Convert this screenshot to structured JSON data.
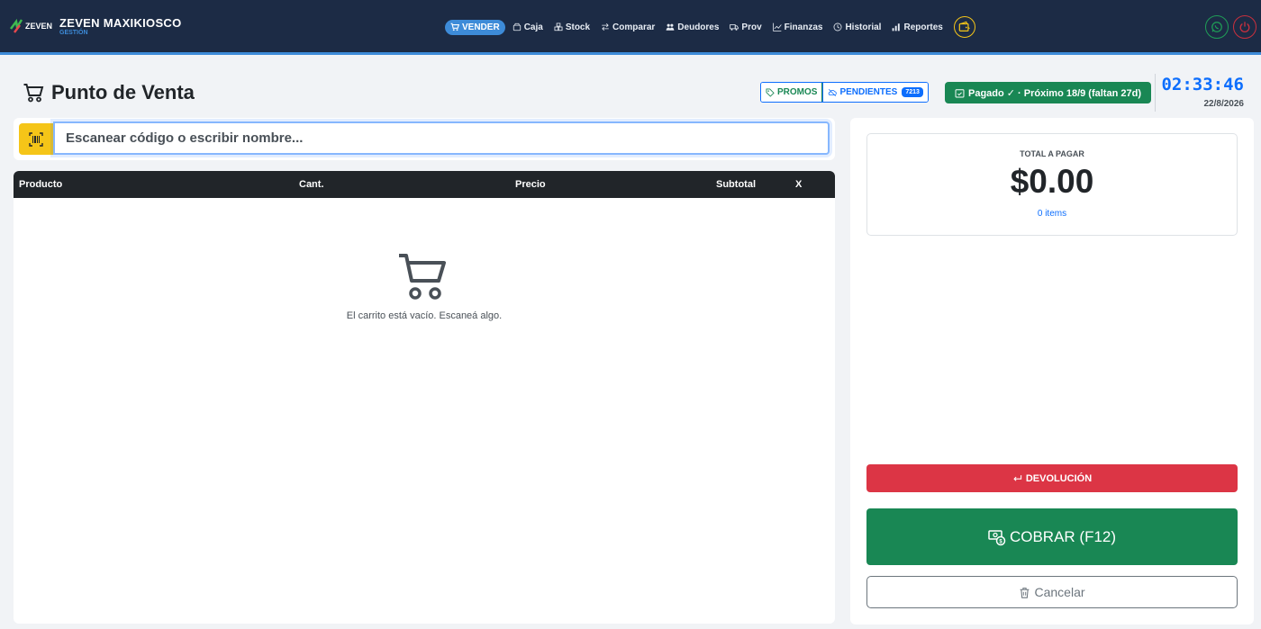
{
  "brand": {
    "logo_text": "ZEVEN",
    "title": "ZEVEN MAXIKIOSCO",
    "subtitle": "GESTIÓN"
  },
  "nav": {
    "items": [
      {
        "label": "VENDER",
        "icon": "cart-icon",
        "active": true
      },
      {
        "label": "Caja",
        "icon": "cash-register-icon"
      },
      {
        "label": "Stock",
        "icon": "boxes-icon"
      },
      {
        "label": "Comparar",
        "icon": "arrows-exchange-icon"
      },
      {
        "label": "Deudores",
        "icon": "people-icon"
      },
      {
        "label": "Prov",
        "icon": "truck-icon"
      },
      {
        "label": "Finanzas",
        "icon": "graph-up-icon"
      },
      {
        "label": "Historial",
        "icon": "clock-history-icon"
      },
      {
        "label": "Reportes",
        "icon": "bar-chart-icon"
      }
    ],
    "wallet_icon": "wallet-icon",
    "whatsapp_icon": "whatsapp-icon",
    "power_icon": "power-icon"
  },
  "header": {
    "title": "Punto de Venta",
    "promos_label": "PROMOS",
    "pendientes_label": "PENDIENTES",
    "pendientes_count": "7213",
    "paid_status": "Pagado ✓ · Próximo 18/9 (faltan 27d)",
    "clock": "02:33:46",
    "date": "22/8/2026"
  },
  "search": {
    "placeholder": "Escanear código o escribir nombre..."
  },
  "cart": {
    "columns": [
      "Producto",
      "Cant.",
      "Precio",
      "Subtotal",
      "X"
    ],
    "empty_message": "El carrito está vacío. Escaneá algo."
  },
  "summary": {
    "total_label": "TOTAL A PAGAR",
    "total_amount": "$0.00",
    "items_text": "0 items"
  },
  "actions": {
    "devolucion": "DEVOLUCIÓN",
    "cobrar": "COBRAR (F12)",
    "cancelar": "Cancelar"
  },
  "colors": {
    "navbar": "#1c2b45",
    "accent": "#3d8bd8",
    "success": "#198754",
    "danger": "#dc3545",
    "warning": "#f5c518",
    "primary": "#0d6efd"
  }
}
